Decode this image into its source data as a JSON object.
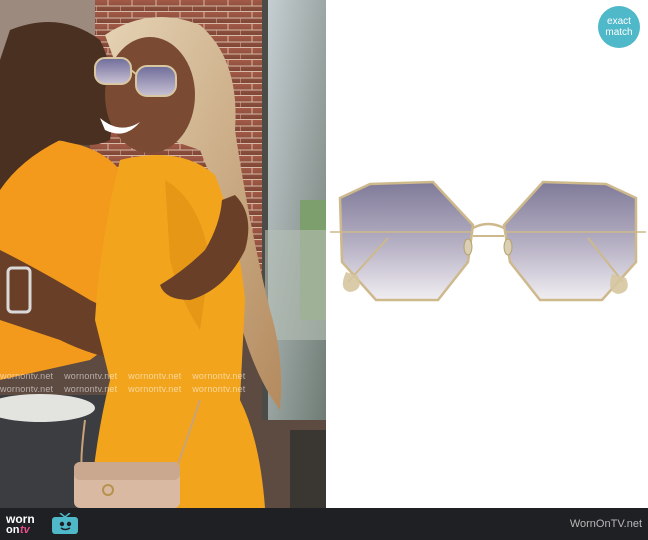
{
  "badge": {
    "line1": "exact",
    "line2": "match"
  },
  "watermark": {
    "text": "wornontv.net"
  },
  "footer": {
    "logo_worn": "worn",
    "logo_on": "on",
    "logo_tv": "tv",
    "site": "WornOnTV.net"
  },
  "colors": {
    "badge": "#4fb8c9",
    "footer_bg": "#1f2023",
    "dress": "#f2a51c",
    "lens_top": "#7f7a98",
    "frame": "#cdb98c"
  },
  "icons": [
    "tv-icon"
  ]
}
